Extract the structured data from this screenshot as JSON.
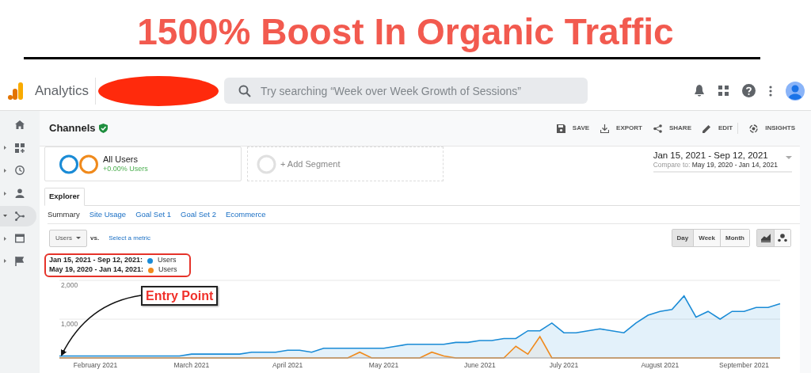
{
  "headline": "1500% Boost In Organic Traffic",
  "app": {
    "name": "Analytics",
    "search_placeholder": "Try searching “Week over Week Growth of Sessions”"
  },
  "sidebar": [
    {
      "kind": "home",
      "selected": false
    },
    {
      "kind": "dashboard",
      "expanded": false,
      "selected": false
    },
    {
      "kind": "clock",
      "expanded": false,
      "selected": false
    },
    {
      "kind": "person",
      "expanded": false,
      "selected": false
    },
    {
      "kind": "acquisition",
      "expanded": true,
      "selected": true
    },
    {
      "kind": "window",
      "expanded": false,
      "selected": false
    },
    {
      "kind": "flag",
      "expanded": false,
      "selected": false
    }
  ],
  "report": {
    "title": "Channels",
    "verified": true
  },
  "actions": [
    {
      "kind": "save",
      "label": "SAVE"
    },
    {
      "kind": "export",
      "label": "EXPORT"
    },
    {
      "kind": "share",
      "label": "SHARE"
    },
    {
      "kind": "edit",
      "label": "EDIT"
    },
    {
      "kind": "insights",
      "label": "INSIGHTS"
    }
  ],
  "segment": {
    "name": "All Users",
    "change": "+0.00% Users"
  },
  "add_segment": "+ Add Segment",
  "date_range": {
    "primary": "Jan 15, 2021 - Sep 12, 2021",
    "compare_label": "Compare to:",
    "compare": "May 19, 2020 - Jan 14, 2021"
  },
  "tabs": [
    {
      "label": "Explorer",
      "selected": true
    }
  ],
  "subtabs": [
    {
      "label": "Summary",
      "selected": true
    },
    {
      "label": "Site Usage",
      "selected": false
    },
    {
      "label": "Goal Set 1",
      "selected": false
    },
    {
      "label": "Goal Set 2",
      "selected": false
    },
    {
      "label": "Ecommerce",
      "selected": false
    }
  ],
  "metric": {
    "value": "Users",
    "vs": "vs.",
    "link": "Select a metric"
  },
  "granularity": [
    {
      "label": "Day",
      "selected": true
    },
    {
      "label": "Week",
      "selected": false
    },
    {
      "label": "Month",
      "selected": false
    }
  ],
  "chart_types": [
    {
      "kind": "line",
      "selected": true
    },
    {
      "kind": "motion",
      "selected": false
    }
  ],
  "legend_ranges": [
    "Jan 15, 2021 - Sep 12, 2021:",
    "May 19, 2020 - Jan 14, 2021:"
  ],
  "chart_data": {
    "type": "area",
    "categories": [
      null,
      null,
      null,
      "February 2021",
      null,
      null,
      null,
      null,
      null,
      null,
      null,
      "March 2021",
      null,
      null,
      null,
      null,
      null,
      null,
      null,
      "April 2021",
      null,
      null,
      null,
      null,
      null,
      null,
      null,
      "May 2021",
      null,
      null,
      null,
      null,
      null,
      null,
      null,
      "June 2021",
      null,
      null,
      null,
      null,
      null,
      null,
      "July 2021",
      null,
      null,
      null,
      null,
      null,
      null,
      null,
      "August 2021",
      null,
      null,
      null,
      null,
      null,
      null,
      "September 2021",
      null,
      null,
      null
    ],
    "series": [
      {
        "name": "Users",
        "color": "#1a8bd6",
        "values": [
          50,
          50,
          50,
          50,
          50,
          50,
          50,
          50,
          50,
          50,
          50,
          100,
          100,
          100,
          100,
          100,
          150,
          150,
          150,
          200,
          200,
          150,
          250,
          250,
          250,
          250,
          250,
          250,
          300,
          350,
          350,
          350,
          350,
          400,
          400,
          450,
          450,
          500,
          500,
          700,
          700,
          900,
          650,
          650,
          700,
          750,
          700,
          650,
          900,
          1100,
          1200,
          1250,
          1600,
          1050,
          1200,
          1000,
          1200,
          1200,
          1300,
          1300,
          1400
        ]
      },
      {
        "name": "Users",
        "color": "#f08a1c",
        "values": [
          0,
          0,
          0,
          0,
          0,
          0,
          0,
          0,
          0,
          0,
          0,
          0,
          0,
          0,
          0,
          0,
          0,
          0,
          0,
          0,
          0,
          0,
          0,
          0,
          0,
          150,
          0,
          0,
          0,
          0,
          0,
          150,
          50,
          0,
          0,
          0,
          0,
          0,
          300,
          100,
          550,
          0,
          0,
          0,
          0,
          0,
          0,
          0,
          0,
          0,
          0,
          0,
          0,
          0,
          0,
          0,
          0,
          0,
          0,
          0,
          0
        ]
      }
    ],
    "ylim": [
      0,
      2000
    ],
    "yticks": [
      {
        "value": 1000,
        "label": "1,000"
      },
      {
        "value": 2000,
        "label": "2,000"
      }
    ],
    "annotations": [
      {
        "text": "Entry Point"
      }
    ]
  }
}
